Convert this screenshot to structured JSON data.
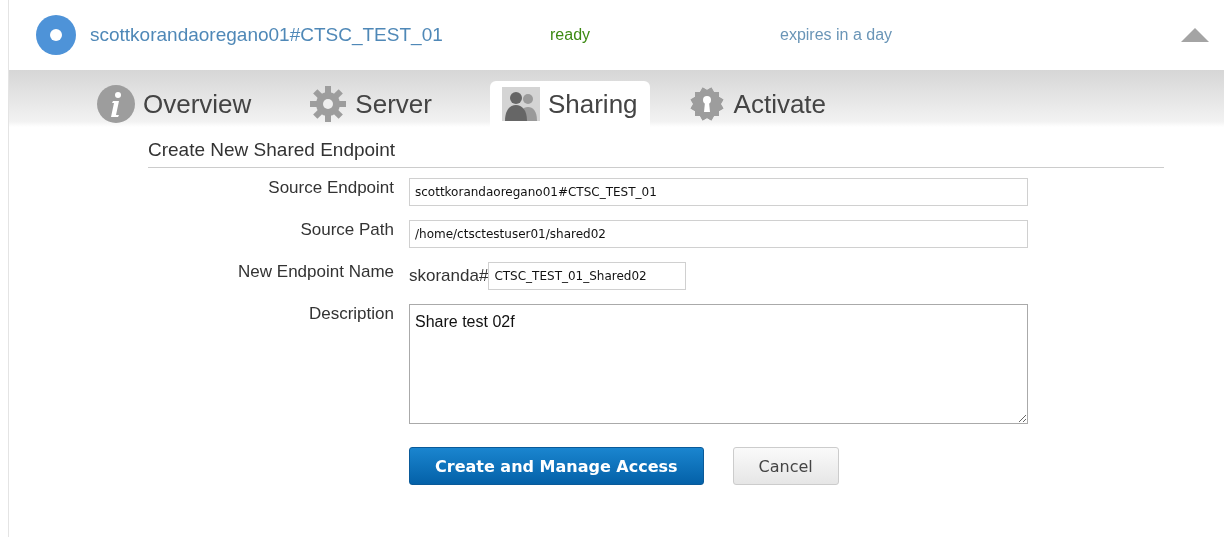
{
  "endpoint": {
    "name": "scottkorandaoregano01#CTSC_TEST_01",
    "status": "ready",
    "expiry": "expires in a day",
    "expanded": true
  },
  "tabs": [
    {
      "kind": "info",
      "label": "Overview",
      "selected": false
    },
    {
      "kind": "gear",
      "label": "Server",
      "selected": false
    },
    {
      "kind": "people",
      "label": "Sharing",
      "selected": true
    },
    {
      "kind": "keyhole",
      "label": "Activate",
      "selected": false
    }
  ],
  "form": {
    "title": "Create New Shared Endpoint",
    "fields": [
      {
        "kind": "text",
        "label": "Source Endpoint",
        "value": "scottkorandaoregano01#CTSC_TEST_01"
      },
      {
        "kind": "text",
        "label": "Source Path",
        "value": "/home/ctsctestuser01/shared02"
      },
      {
        "kind": "prefixed",
        "label": "New Endpoint Name",
        "prefix": "skoranda#",
        "value": "CTSC_TEST_01_Shared02"
      },
      {
        "kind": "textarea",
        "label": "Description",
        "value": "Share test 02f"
      }
    ],
    "buttons": [
      {
        "kind": "primary",
        "label": "Create and Manage Access"
      },
      {
        "kind": "secondary",
        "label": "Cancel"
      }
    ]
  }
}
